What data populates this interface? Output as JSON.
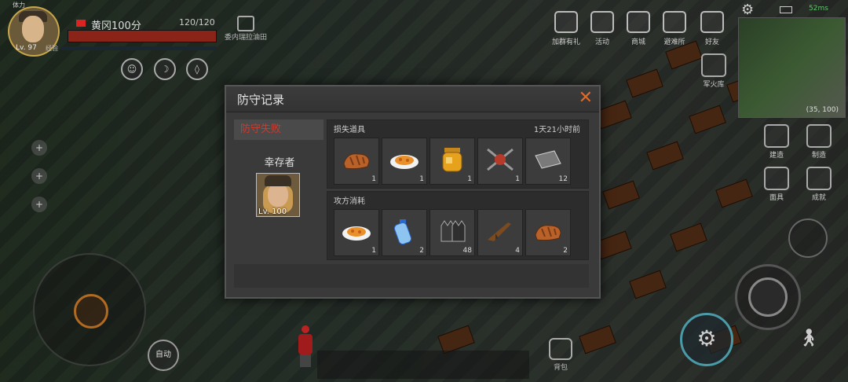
{
  "player": {
    "stamina_label": "体力",
    "level": "Lv. 97",
    "name": "黄冈100分",
    "hp": "120/120",
    "hp_fraction": 1.0,
    "exp_label": "经验",
    "exp_fraction": 0.0
  },
  "oilfield": {
    "label": "委内瑞拉油田",
    "icon": "oil-derrick-icon"
  },
  "top_menu": [
    {
      "label": "加群有礼",
      "icon": "chat-gift-icon"
    },
    {
      "label": "活动",
      "icon": "calendar-icon"
    },
    {
      "label": "商城",
      "icon": "shop-icon"
    },
    {
      "label": "避难所",
      "icon": "shelter-icon"
    },
    {
      "label": "好友",
      "icon": "friends-icon"
    }
  ],
  "side_menu": [
    {
      "label": "军火库",
      "icon": "ammo-crate-icon"
    },
    {
      "label": "建造",
      "icon": "build-icon"
    },
    {
      "label": "制造",
      "icon": "craft-icon"
    },
    {
      "label": "面具",
      "icon": "mask-icon"
    },
    {
      "label": "成就",
      "icon": "trophy-icon"
    }
  ],
  "minimap": {
    "coords": "(35, 100)"
  },
  "status": {
    "time": "52ms"
  },
  "auto_label": "自动",
  "bag_label": "背包",
  "dialog": {
    "title": "防守记录",
    "result_tab": "防守失败",
    "survivor_label": "幸存者",
    "survivor_level": "Lv. 100",
    "lost_section": {
      "title": "损失道具",
      "time_ago": "1天21小时前",
      "items": [
        {
          "name": "bread-icon",
          "count": "1"
        },
        {
          "name": "pasta-dish-icon",
          "count": "1"
        },
        {
          "name": "honey-jar-icon",
          "count": "1"
        },
        {
          "name": "spiked-weapon-icon",
          "count": "1"
        },
        {
          "name": "metal-plate-icon",
          "count": "12"
        }
      ]
    },
    "attacker_section": {
      "title": "攻方消耗",
      "items": [
        {
          "name": "pasta-dish-icon",
          "count": "1"
        },
        {
          "name": "water-bottle-icon",
          "count": "2"
        },
        {
          "name": "gloves-icon",
          "count": "48"
        },
        {
          "name": "assault-rifle-icon",
          "count": "4"
        },
        {
          "name": "bread-icon",
          "count": "2"
        }
      ]
    }
  },
  "colors": {
    "accent_orange": "#e06a2a",
    "fail_red": "#c83c30",
    "hp_red": "#8a2418"
  }
}
